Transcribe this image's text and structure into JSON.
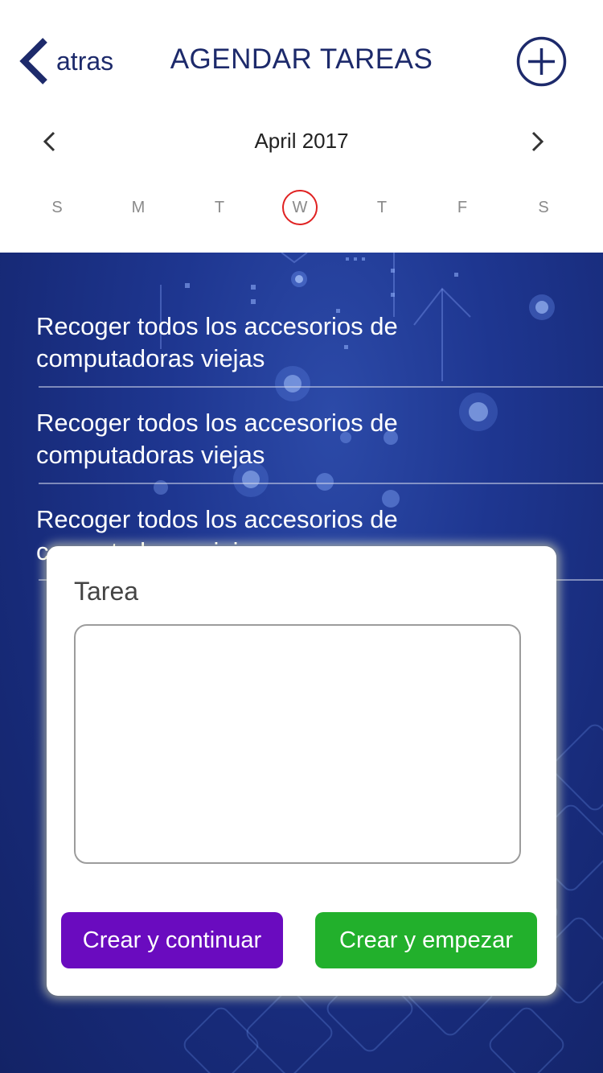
{
  "header": {
    "back_label": "atras",
    "title": "AGENDAR TAREAS",
    "accent_color": "#1d2a6b"
  },
  "calendar": {
    "month_label": "April 2017",
    "days": [
      {
        "label": "S",
        "today": false
      },
      {
        "label": "M",
        "today": false
      },
      {
        "label": "T",
        "today": false
      },
      {
        "label": "W",
        "today": true
      },
      {
        "label": "T",
        "today": false
      },
      {
        "label": "F",
        "today": false
      },
      {
        "label": "S",
        "today": false
      }
    ],
    "today_ring_color": "#e02222"
  },
  "tasks": [
    {
      "text": "Recoger todos los accesorios de computadoras viejas"
    },
    {
      "text": "Recoger todos los accesorios de computadoras viejas"
    },
    {
      "text": "Recoger todos los accesorios de computadoras viejas"
    }
  ],
  "modal": {
    "label": "Tarea",
    "textarea_value": "",
    "continue_label": "Crear y continuar",
    "start_label": "Crear y empezar",
    "continue_color": "#6a0bbf",
    "start_color": "#22b02c"
  },
  "icons": {
    "back": "chevron-left-icon",
    "add": "plus-circle-icon",
    "prev_month": "chevron-left-icon",
    "next_month": "chevron-right-icon"
  }
}
